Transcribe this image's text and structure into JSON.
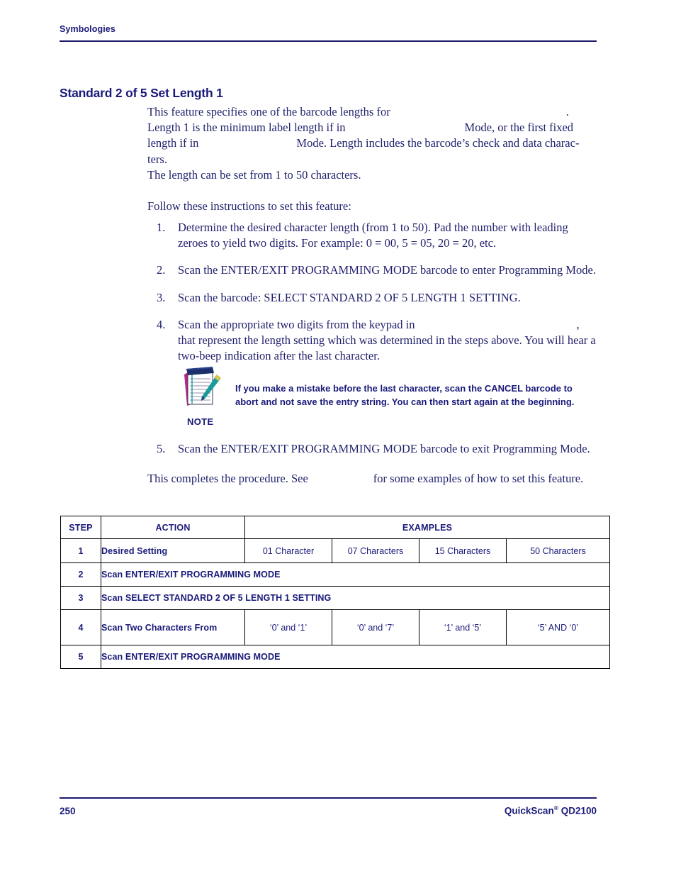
{
  "header": {
    "running_title": "Symbologies"
  },
  "section": {
    "title": "Standard 2 of 5 Set Length 1"
  },
  "intro": {
    "line1_a": "This feature specifies one of the barcode lengths for",
    "line1_b": ".",
    "line2_a": "Length 1 is the minimum label length if in",
    "line2_b": "Mode, or the first fixed",
    "line3_a": "length if in",
    "line3_b": "Mode. Length includes the barcode’s check and data charac-",
    "line4": "ters.",
    "line5": "The length can be set from 1 to 50 characters.",
    "follow": "Follow these instructions to set this feature:"
  },
  "steps": [
    {
      "num": "1.",
      "text": "Determine the desired character length (from 1 to 50). Pad the number with leading zeroes to yield two digits. For example: 0 = 00, 5 = 05, 20 = 20, etc."
    },
    {
      "num": "2.",
      "text": "Scan the ENTER/EXIT PROGRAMMING MODE barcode to enter Programming Mode."
    },
    {
      "num": "3.",
      "text": "Scan the barcode: SELECT STANDARD 2 OF 5 LENGTH 1 SETTING."
    },
    {
      "num": "4.",
      "text_a": "Scan the appropriate two digits from the keypad in",
      "text_b": ", that represent the length setting which was determined in the steps above. You will hear a two-beep indication after the last character."
    },
    {
      "num": "5.",
      "text": "Scan the ENTER/EXIT PROGRAMMING MODE barcode to exit Programming Mode."
    }
  ],
  "note": {
    "label": "NOTE",
    "icon": "notepad-pen-icon",
    "text": "If you make a mistake before the last character, scan the CANCEL barcode to abort and not save the entry string. You can then start again at the beginning."
  },
  "closing": {
    "text_a": "This completes the procedure. See",
    "text_b": "for some examples of how to set this feature."
  },
  "table": {
    "headers": {
      "step": "STEP",
      "action": "ACTION",
      "examples": "EXAMPLES"
    },
    "rows": [
      {
        "step": "1",
        "action": "Desired Setting",
        "spans_examples": false,
        "examples": [
          "01 Character",
          "07 Characters",
          "15 Characters",
          "50 Characters"
        ]
      },
      {
        "step": "2",
        "action": "Scan ENTER/EXIT PROGRAMMING MODE",
        "spans_examples": true,
        "examples": []
      },
      {
        "step": "3",
        "action": "Scan SELECT STANDARD 2 OF 5 LENGTH 1 SETTING",
        "spans_examples": true,
        "examples": []
      },
      {
        "step": "4",
        "action": "Scan Two Characters From",
        "spans_examples": false,
        "examples": [
          "‘0’ and ‘1’",
          "‘0’ and ‘7’",
          "‘1’ and ‘5’",
          "‘5’ AND ‘0’"
        ]
      },
      {
        "step": "5",
        "action": "Scan ENTER/EXIT PROGRAMMING MODE",
        "spans_examples": true,
        "examples": []
      }
    ]
  },
  "footer": {
    "page_number": "250",
    "product_name": "QuickScan",
    "product_mark": "®",
    "product_model": " QD2100"
  },
  "colors": {
    "navy": "#1a1a7a",
    "body_text": "#22226e",
    "rule": "#1a1a6e",
    "note_pen": "#1a9a9a",
    "note_page_back": "#b5258a",
    "note_binding": "#1d2f6b"
  }
}
